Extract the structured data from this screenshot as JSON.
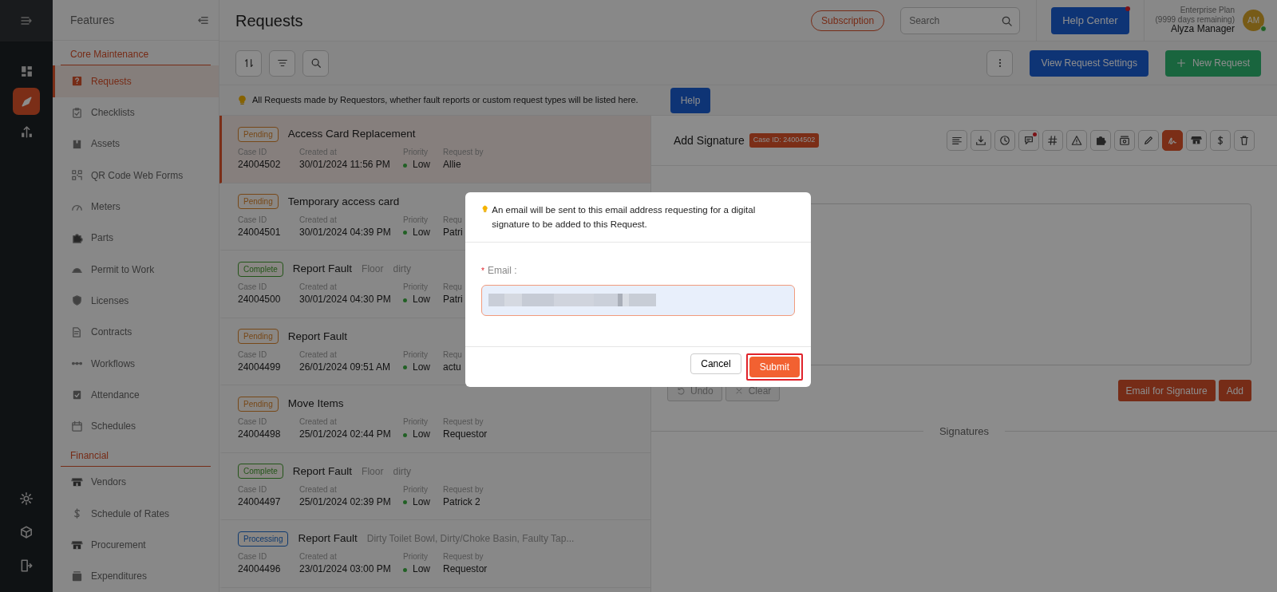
{
  "rail": {
    "items": [
      {
        "selected": false
      },
      {
        "selected": true
      },
      {
        "selected": false
      }
    ]
  },
  "features": {
    "title": "Features",
    "sections": [
      {
        "heading": "Core Maintenance",
        "items": [
          {
            "label": "Requests",
            "selected": true
          },
          {
            "label": "Checklists",
            "selected": false
          },
          {
            "label": "Assets",
            "selected": false
          },
          {
            "label": "QR Code Web Forms",
            "selected": false
          },
          {
            "label": "Meters",
            "selected": false
          },
          {
            "label": "Parts",
            "selected": false
          },
          {
            "label": "Permit to Work",
            "selected": false
          },
          {
            "label": "Licenses",
            "selected": false
          },
          {
            "label": "Contracts",
            "selected": false
          },
          {
            "label": "Workflows",
            "selected": false
          },
          {
            "label": "Attendance",
            "selected": false
          },
          {
            "label": "Schedules",
            "selected": false
          }
        ]
      },
      {
        "heading": "Financial",
        "items": [
          {
            "label": "Vendors",
            "selected": false
          },
          {
            "label": "Schedule of Rates",
            "selected": false
          },
          {
            "label": "Procurement",
            "selected": false
          },
          {
            "label": "Expenditures",
            "selected": false
          }
        ]
      }
    ]
  },
  "header": {
    "title": "Requests",
    "subscription": "Subscription",
    "search_placeholder": "Search",
    "help_center": "Help Center",
    "help_center_notification": true,
    "plan": "Enterprise Plan",
    "plan_days": "(9999 days remaining)",
    "user_name": "Alyza Manager",
    "avatar_initials": "AM",
    "online": true
  },
  "toolbar": {
    "settings_button": "View Request Settings",
    "new_button": "New Request"
  },
  "info": {
    "text": "All Requests made by Requestors, whether fault reports or custom request types will be listed here.",
    "help_button": "Help"
  },
  "requests": [
    {
      "status": "Pending",
      "color": "#774818",
      "title": "Access Card Replacement",
      "case_id_label": "Case ID",
      "case_id": "24004502",
      "created_label": "Created at",
      "created": "30/01/2024 11:56 PM",
      "priority_label": "Priority",
      "priority": "Low",
      "requested_label": "Request by",
      "requested_by": "Allie",
      "selected": true
    },
    {
      "status": "Pending",
      "color": "#774818",
      "title": "Temporary access card",
      "case_id_label": "Case ID",
      "case_id": "24004501",
      "created_label": "Created at",
      "created": "30/01/2024 04:39 PM",
      "priority_label": "Priority",
      "priority": "Low",
      "requested_label": "Requ",
      "requested_by": "Patri",
      "selected": false
    },
    {
      "status": "Complete",
      "color": "#235519",
      "title": "Report Fault",
      "tags": [
        "Floor",
        "dirty"
      ],
      "case_id_label": "Case ID",
      "case_id": "24004500",
      "created_label": "Created at",
      "created": "30/01/2024 04:30 PM",
      "priority_label": "Priority",
      "priority": "Low",
      "requested_label": "Requ",
      "requested_by": "Patri",
      "selected": false
    },
    {
      "status": "Pending",
      "color": "#774818",
      "title": "Report Fault",
      "case_id_label": "Case ID",
      "case_id": "24004499",
      "created_label": "Created at",
      "created": "26/01/2024 09:51 AM",
      "priority_label": "Priority",
      "priority": "Low",
      "requested_label": "Requ",
      "requested_by": "actu",
      "selected": false
    },
    {
      "status": "Pending",
      "color": "#774818",
      "title": "Move Items",
      "case_id_label": "Case ID",
      "case_id": "24004498",
      "created_label": "Created at",
      "created": "25/01/2024 02:44 PM",
      "priority_label": "Priority",
      "priority": "Low",
      "requested_label": "Request by",
      "requested_by": "Requestor",
      "selected": false
    },
    {
      "status": "Complete",
      "color": "#235519",
      "title": "Report Fault",
      "tags": [
        "Floor",
        "dirty"
      ],
      "case_id_label": "Case ID",
      "case_id": "24004497",
      "created_label": "Created at",
      "created": "25/01/2024 02:39 PM",
      "priority_label": "Priority",
      "priority": "Low",
      "requested_label": "Request by",
      "requested_by": "Patrick 2",
      "selected": false
    },
    {
      "status": "Processing",
      "color": "#0f3a6f",
      "title": "Report Fault",
      "tags": [
        "Dirty Toilet Bowl, Dirty/Choke Basin, Faulty Tap..."
      ],
      "case_id_label": "Case ID",
      "case_id": "24004496",
      "created_label": "Created at",
      "created": "23/01/2024 03:00 PM",
      "priority_label": "Priority",
      "priority": "Low",
      "requested_label": "Request by",
      "requested_by": "Requestor",
      "selected": false
    }
  ],
  "detail": {
    "title": "Add Signature",
    "case_badge": "Case ID: 24004502",
    "tools": [
      {
        "selected": false
      },
      {
        "selected": false
      },
      {
        "selected": false
      },
      {
        "selected": false,
        "notification": true
      },
      {
        "selected": false
      },
      {
        "selected": false
      },
      {
        "selected": false
      },
      {
        "selected": false
      },
      {
        "selected": false
      },
      {
        "selected": true
      },
      {
        "selected": false
      },
      {
        "selected": false
      },
      {
        "selected": false
      }
    ],
    "undo": "Undo",
    "clear": "Clear",
    "email_button": "Email for Signature",
    "add_button": "Add",
    "signatures_heading": "Signatures"
  },
  "modal": {
    "message": "An email will be sent to this email address requesting for a digital signature to be added to this Request.",
    "required_mark": "*",
    "email_label": "Email :",
    "value_redacted": true,
    "cancel": "Cancel",
    "submit": "Submit",
    "submit_highlighted": true
  }
}
